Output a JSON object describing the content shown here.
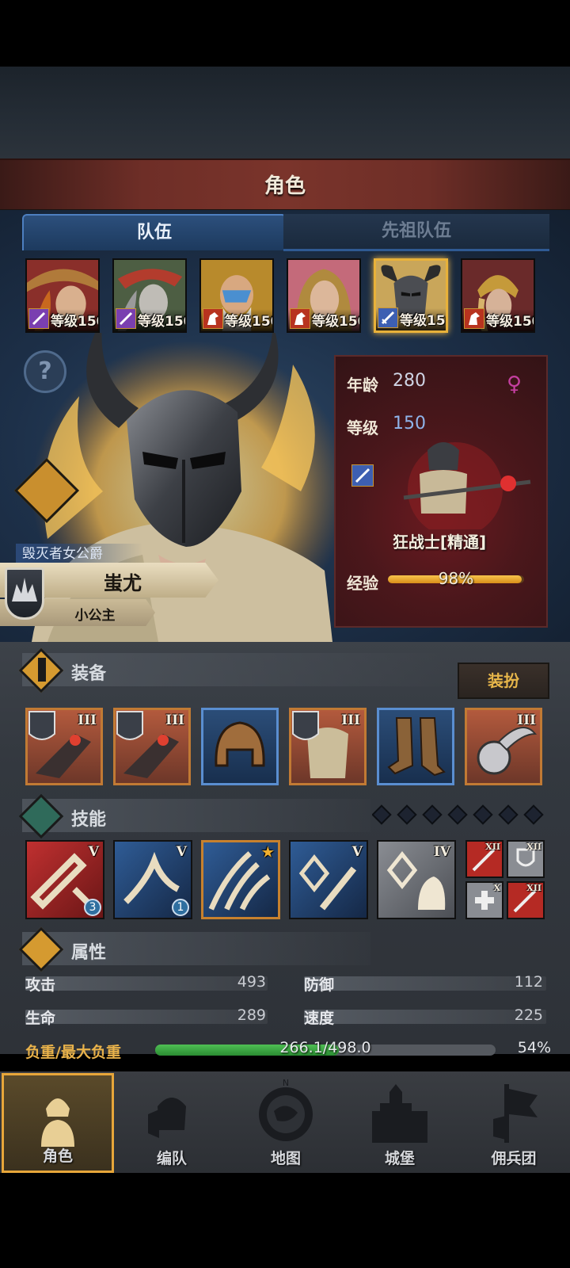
{
  "header": {
    "title": "角色"
  },
  "tabs": [
    {
      "label": "队伍",
      "active": true
    },
    {
      "label": "先祖队伍",
      "active": false
    }
  ],
  "roster": [
    {
      "level_text": "等级150",
      "class_icon": "staff-icon",
      "class_color": "#7a3fb0"
    },
    {
      "level_text": "等级150",
      "class_icon": "staff-icon",
      "class_color": "#7a3fb0"
    },
    {
      "level_text": "等级150",
      "class_icon": "horse-icon",
      "class_color": "#b8331f"
    },
    {
      "level_text": "等级150",
      "class_icon": "horse-icon",
      "class_color": "#b8331f"
    },
    {
      "level_text": "等级150",
      "class_icon": "sword-icon",
      "class_color": "#3d5fb2",
      "selected": true
    },
    {
      "level_text": "等级150",
      "class_icon": "horse-icon",
      "class_color": "#b8331f"
    }
  ],
  "hero": {
    "title": "毁灭者女公爵",
    "name": "蚩尤",
    "subtitle": "小公主"
  },
  "info": {
    "age_label": "年龄",
    "age": "280",
    "level_label": "等级",
    "level": "150",
    "gender_icon": "female-icon",
    "class_name": "狂战士[精通]",
    "exp_label": "经验",
    "exp_text": "98%",
    "exp_fraction": 0.98
  },
  "equipment": {
    "title": "装备",
    "dress_button": "装扮",
    "slots": [
      {
        "tier": "III",
        "type": "weapon",
        "rarity": "orange"
      },
      {
        "tier": "III",
        "type": "weapon",
        "rarity": "orange"
      },
      {
        "tier": "",
        "type": "helmet",
        "rarity": "blue"
      },
      {
        "tier": "III",
        "type": "armor",
        "rarity": "orange"
      },
      {
        "tier": "",
        "type": "boots",
        "rarity": "blue"
      },
      {
        "tier": "III",
        "type": "accessory",
        "rarity": "orange"
      }
    ]
  },
  "skills": {
    "title": "技能",
    "items": [
      {
        "tier": "V",
        "badge": "3",
        "bg": "red"
      },
      {
        "tier": "V",
        "badge": "1",
        "bg": "blue"
      },
      {
        "tier": "★",
        "badge": "",
        "bg": "blue"
      },
      {
        "tier": "V",
        "badge": "",
        "bg": "blue"
      },
      {
        "tier": "IV",
        "badge": "",
        "bg": "gray"
      }
    ],
    "mini": [
      {
        "tier": "XII",
        "bg": "red"
      },
      {
        "tier": "XII",
        "bg": "gray"
      },
      {
        "tier": "X",
        "bg": "gray"
      },
      {
        "tier": "XII",
        "bg": "red"
      }
    ]
  },
  "attributes": {
    "title": "属性",
    "attack_label": "攻击",
    "attack": "493",
    "defense_label": "防御",
    "defense": "112",
    "hp_label": "生命",
    "hp": "289",
    "speed_label": "速度",
    "speed": "225",
    "load_label": "负重/最大负重",
    "load_text": "266.1/498.0",
    "load_pct": "54%",
    "load_fraction": 0.54
  },
  "nav": [
    {
      "label": "角色",
      "active": true
    },
    {
      "label": "编队"
    },
    {
      "label": "地图"
    },
    {
      "label": "城堡"
    },
    {
      "label": "佣兵团"
    }
  ],
  "colors": {
    "accent_gold": "#e8b13a",
    "title_red": "#7a342b",
    "tab_blue": "#4d7fc0"
  }
}
